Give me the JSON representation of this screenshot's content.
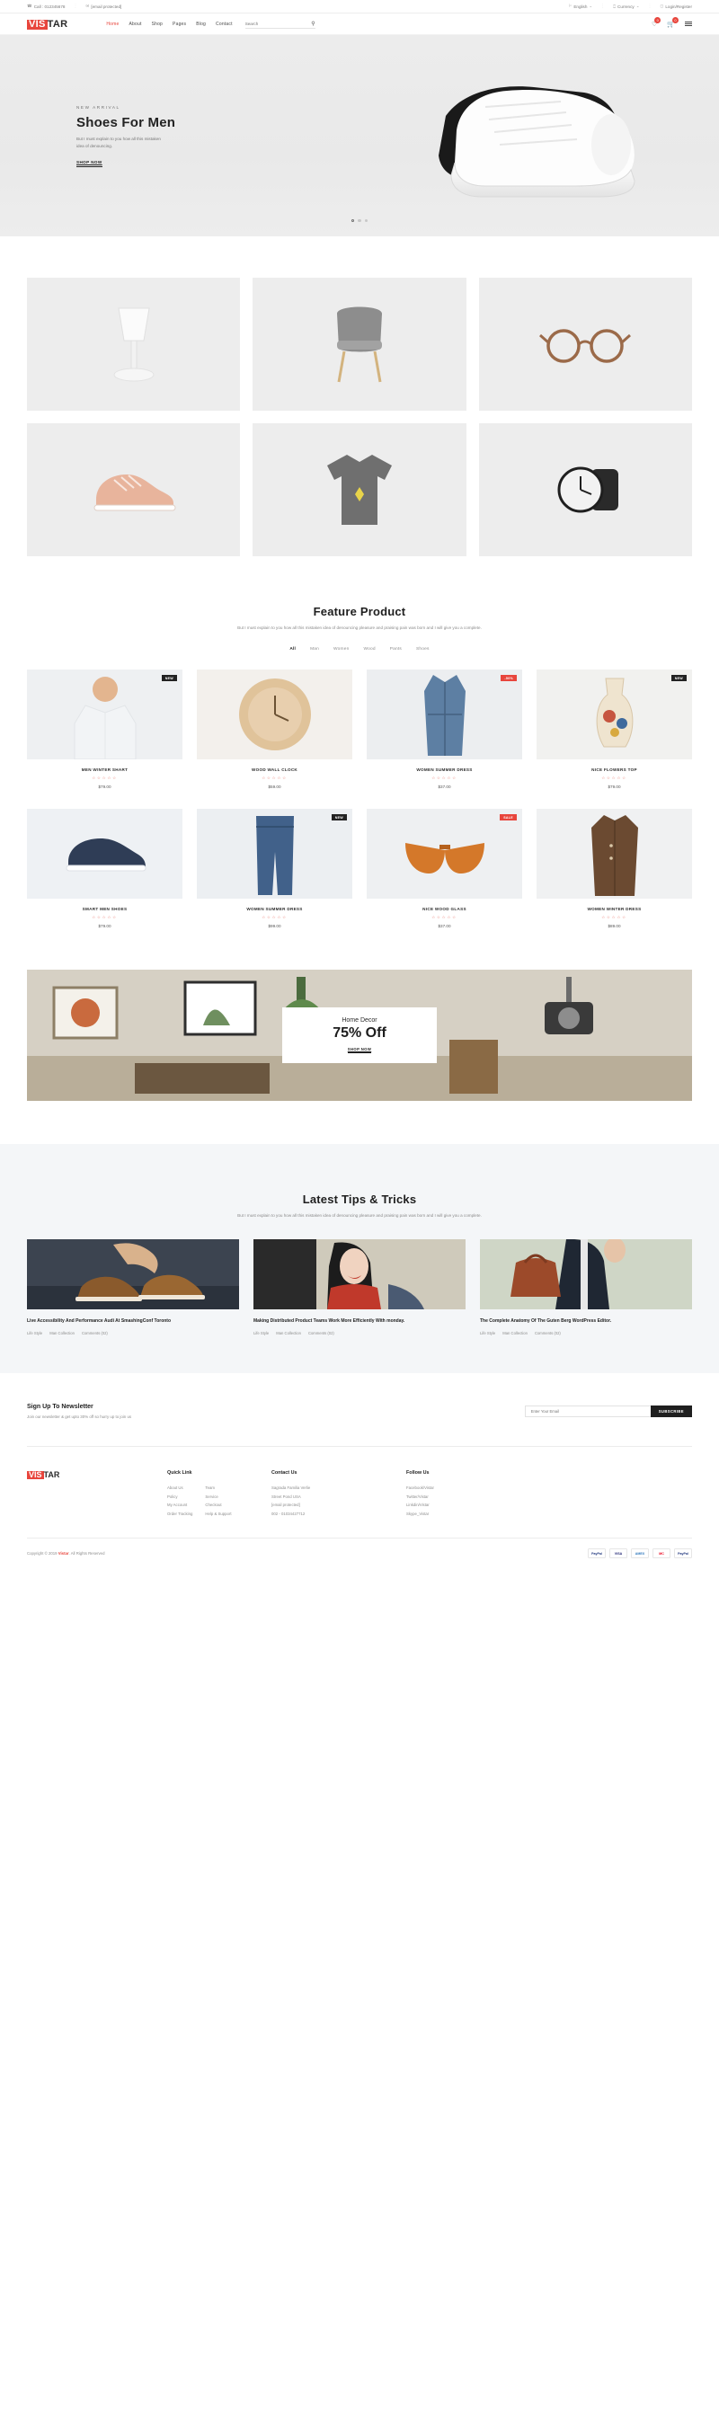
{
  "topbar": {
    "phone": "Call : 012345678",
    "email": "[email protected]",
    "language": "English",
    "currency": "Currency",
    "account": "Login/Register"
  },
  "header": {
    "logo_first": "VIS",
    "logo_second": "TAR",
    "nav": [
      {
        "label": "Home",
        "active": true
      },
      {
        "label": "About",
        "active": false
      },
      {
        "label": "Shop",
        "active": false
      },
      {
        "label": "Pages",
        "active": false
      },
      {
        "label": "Blog",
        "active": false
      },
      {
        "label": "Contact",
        "active": false
      }
    ],
    "search_placeholder": "Search",
    "wishlist_count": "0",
    "cart_count": "0"
  },
  "hero": {
    "eyebrow": "NEW ARRIVAL",
    "title": "Shoes For Men",
    "subtitle": "But I must explain to you how all this mistaken idea of denouncing.",
    "button": "SHOP NOW",
    "slide_count": 3,
    "active_slide": 1
  },
  "categories": [
    {
      "name": "table-lamp"
    },
    {
      "name": "lounge-chair"
    },
    {
      "name": "eyeglasses"
    },
    {
      "name": "sneaker"
    },
    {
      "name": "graphic-tshirt"
    },
    {
      "name": "wrist-watch"
    }
  ],
  "feature": {
    "title": "Feature Product",
    "subtitle": "But I must explain to you how all this mistaken idea of denouncing pleasure and praising pain was born and I will give you a complete.",
    "filters": [
      {
        "label": "All",
        "active": true
      },
      {
        "label": "Man",
        "active": false
      },
      {
        "label": "Women",
        "active": false
      },
      {
        "label": "Wood",
        "active": false
      },
      {
        "label": "Pants",
        "active": false
      },
      {
        "label": "Shoes",
        "active": false
      }
    ],
    "products": [
      {
        "name": "MEN WINTER SHART",
        "price": "$79.00",
        "stars": "☆☆☆☆☆",
        "tag": "NEW",
        "tag_type": "new"
      },
      {
        "name": "WOOD WALL CLOCK",
        "price": "$59.00",
        "stars": "☆☆☆☆☆",
        "tag": "",
        "tag_type": ""
      },
      {
        "name": "WOMEN SUMMER DRESS",
        "price": "$37.00",
        "stars": "☆☆☆☆☆",
        "tag": "-50%",
        "tag_type": "sale"
      },
      {
        "name": "NICE FLOWERS TOP",
        "price": "$79.00",
        "stars": "☆☆☆☆☆",
        "tag": "NEW",
        "tag_type": "new"
      },
      {
        "name": "SMART MEN SHOES",
        "price": "$79.00",
        "stars": "☆☆☆☆☆",
        "tag": "",
        "tag_type": ""
      },
      {
        "name": "WOMEN SUMMER DRESS",
        "price": "$99.00",
        "stars": "☆☆☆☆☆",
        "tag": "NEW",
        "tag_type": "new"
      },
      {
        "name": "NICE WOOD GLASS",
        "price": "$37.00",
        "stars": "☆☆☆☆☆",
        "tag": "SALE",
        "tag_type": "sale"
      },
      {
        "name": "WOMEN WINTER DRESS",
        "price": "$89.00",
        "stars": "☆☆☆☆☆",
        "tag": "",
        "tag_type": ""
      }
    ]
  },
  "promo": {
    "line1": "Home Decor",
    "line2": "75% Off",
    "button": "SHOP NOW"
  },
  "blog": {
    "title": "Latest Tips & Tricks",
    "subtitle": "But I must explain to you how all this mistaken idea of denouncing pleasure and praising pain was born and I will give you a complete.",
    "posts": [
      {
        "title": "Live Accessibility And Performance Audi At SmashingConf Toronto",
        "category": "Life Style",
        "collection": "Man Collection",
        "comments": "Comments (02)",
        "image": "man-tying-brown-shoes"
      },
      {
        "title": "Making Distributed Product Teams Work More Efficiently With monday.",
        "category": "Life Style",
        "collection": "Man Collection",
        "comments": "Comments (02)",
        "image": "woman-red-lips-fashion"
      },
      {
        "title": "The Complete Anatomy Of The Guten Berg WordPress Editor.",
        "category": "Life Style",
        "collection": "Man Collection",
        "comments": "Comments (02)",
        "image": "woman-with-brown-handbag"
      }
    ]
  },
  "newsletter": {
    "title": "Sign Up To Newsletter",
    "subtitle": "Join our newsletter & get upto 30% off so hurry up to join us",
    "placeholder": "Enter Your Email",
    "button": "SUBSCRIBE"
  },
  "footer": {
    "logo_first": "VIS",
    "logo_second": "TAR",
    "columns": [
      {
        "heading": "Quick Link",
        "links_a": [
          "About Us",
          "Policy",
          "My Account",
          "Order Tracking"
        ],
        "links_b": [
          "Team",
          "Service",
          "Checkout",
          "Help & Support"
        ]
      },
      {
        "heading": "Contact Us",
        "links_a": [
          "Sagrada Familia Verlie",
          "Street Pond USA",
          "[email protected]",
          "002 - 01034427712"
        ]
      },
      {
        "heading": "Follow Us",
        "links_a": [
          "Facebook/Vistar",
          "Twitter/Vistar",
          "Linkdin/Vistar",
          "Skype_Vistar"
        ]
      }
    ],
    "copyright_pre": "Copyright © 2019 ",
    "copyright_brand": "Vistar",
    "copyright_post": ". All Rights Reserved",
    "payments": [
      "PayPal",
      "VISA",
      "AMEX",
      "MC",
      "PayPal"
    ]
  },
  "colors": {
    "accent": "#e8453c",
    "dark": "#1f1f1f",
    "muted": "#8d8d8d"
  }
}
